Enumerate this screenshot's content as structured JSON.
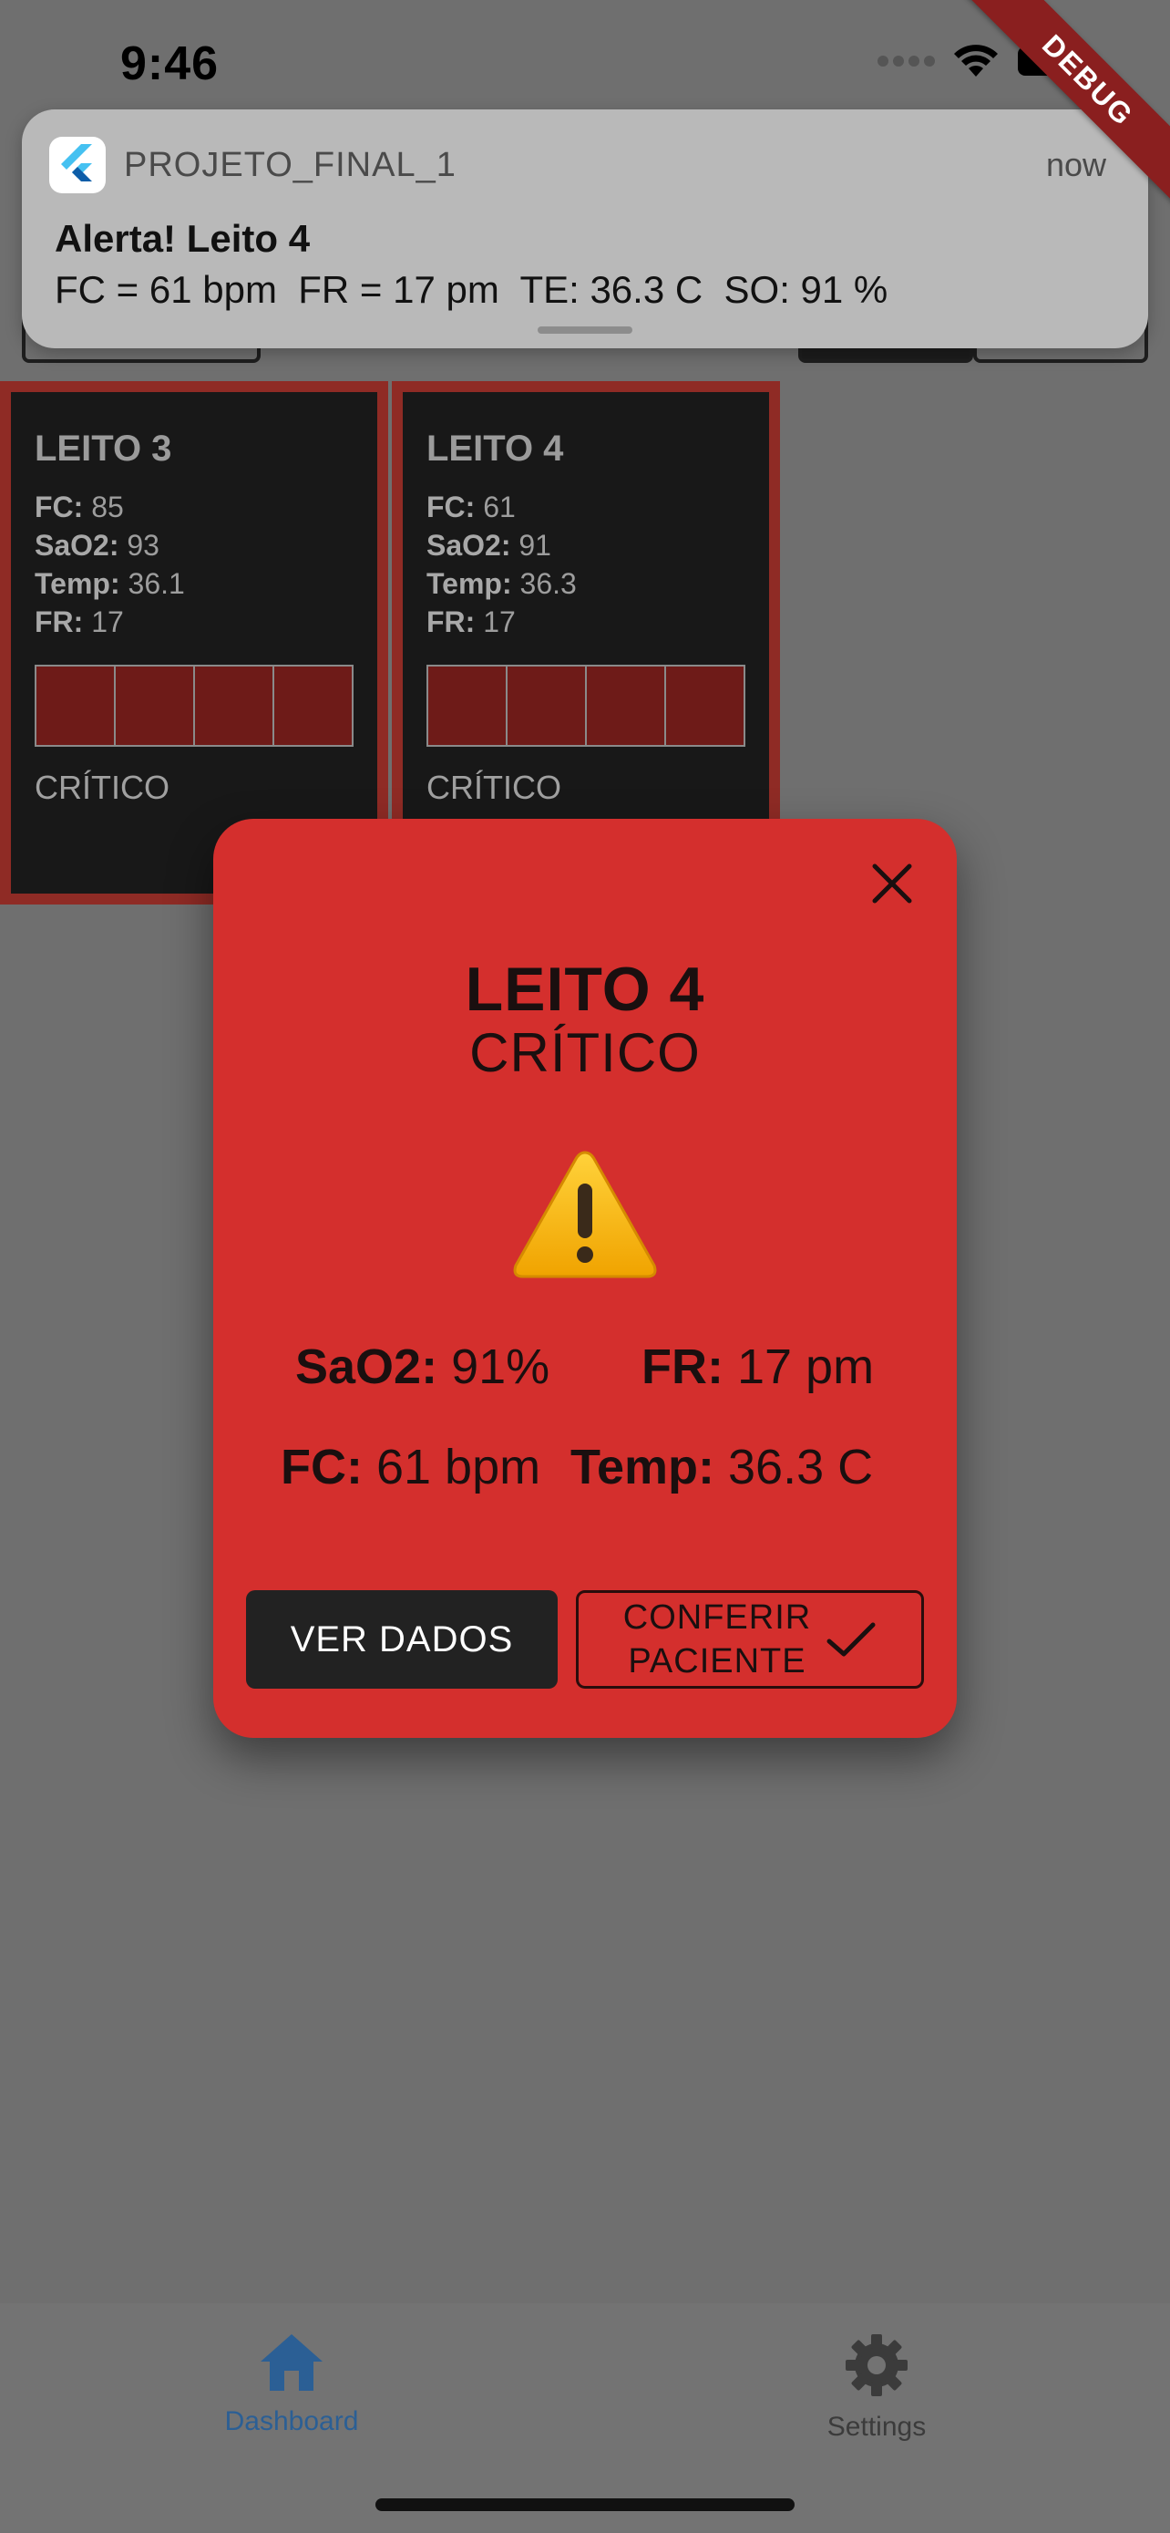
{
  "status_bar": {
    "time": "9:46"
  },
  "debug_ribbon": "DEBUG",
  "notification": {
    "app_name": "PROJETO_FINAL_1",
    "time": "now",
    "title": "Alerta! Leito 4",
    "body": "FC = 61 bpm  FR = 17 pm  TE: 36.3 C  SO: 91 %",
    "app_icon": "flutter-icon"
  },
  "beds": [
    {
      "title": "LEITO 3",
      "fc_label": "FC:",
      "fc": "85",
      "sao2_label": "SaO2:",
      "sao2": "93",
      "temp_label": "Temp:",
      "temp": "36.1",
      "fr_label": "FR:",
      "fr": "17",
      "status": "CRÍTICO"
    },
    {
      "title": "LEITO 4",
      "fc_label": "FC:",
      "fc": "61",
      "sao2_label": "SaO2:",
      "sao2": "91",
      "temp_label": "Temp:",
      "temp": "36.3",
      "fr_label": "FR:",
      "fr": "17",
      "status": "CRÍTICO"
    }
  ],
  "dialog": {
    "title": "LEITO 4",
    "status": "CRÍTICO",
    "icon": "warning-icon",
    "stats": {
      "sao2_label": "SaO2:",
      "sao2_value": "91%",
      "fr_label": "FR:",
      "fr_value": "17 pm",
      "fc_label": "FC:",
      "fc_value": "61 bpm",
      "temp_label": "Temp:",
      "temp_value": "36.3 C"
    },
    "ver_dados_label": "VER DADOS",
    "conferir_line1": "CONFERIR",
    "conferir_line2": "PACIENTE"
  },
  "bottom_nav": {
    "items": [
      {
        "label": "Dashboard",
        "icon": "home-icon",
        "active": true
      },
      {
        "label": "Settings",
        "icon": "gear-icon",
        "active": false
      }
    ]
  },
  "colors": {
    "dialog_bg": "#d42f2d",
    "critical_border": "#8f2b25",
    "nav_active": "#2b5f95"
  }
}
